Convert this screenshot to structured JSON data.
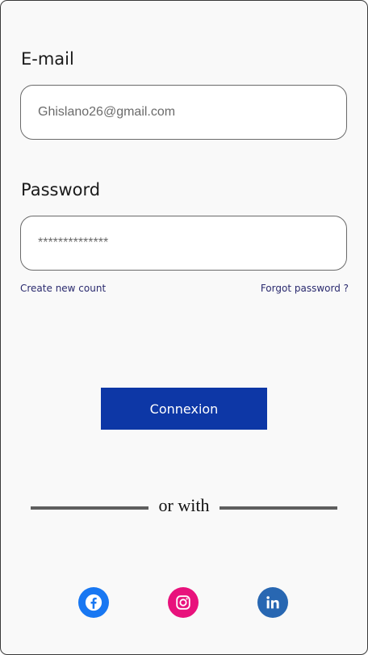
{
  "login": {
    "email_label": "E-mail",
    "email_value": "Ghislano26@gmail.com",
    "password_label": "Password",
    "password_value": "**************",
    "create_account_link": "Create new count",
    "forgot_password_link": "Forgot password ?",
    "submit_label": "Connexion",
    "divider_text": "or with"
  },
  "social": [
    {
      "icon": "facebook-icon",
      "color": "#1877f2"
    },
    {
      "icon": "instagram-icon",
      "color": "#e8127c"
    },
    {
      "icon": "linkedin-icon",
      "color": "#2867b2"
    }
  ],
  "colors": {
    "accent": "#0d37a6",
    "link": "#2a2a6e",
    "background": "#f9f9f9"
  }
}
